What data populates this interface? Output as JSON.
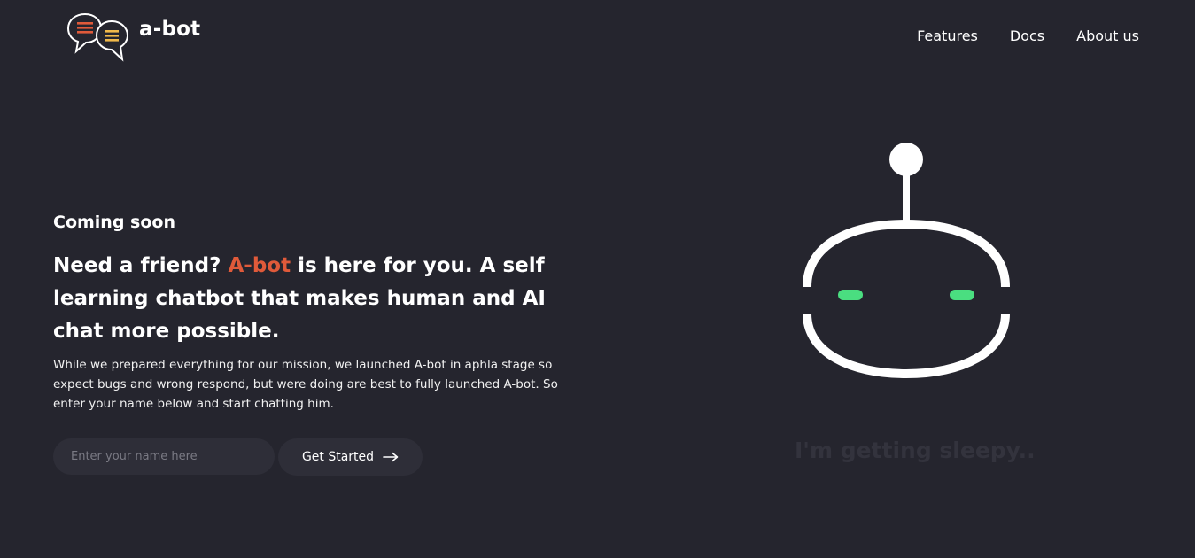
{
  "header": {
    "brand": "a-bot",
    "logo_icon": "chat-bubbles-icon",
    "nav": [
      {
        "label": "Features"
      },
      {
        "label": "Docs"
      },
      {
        "label": "About us"
      }
    ]
  },
  "hero": {
    "eyebrow": "Coming soon",
    "headline_before": "Need a friend? ",
    "headline_accent": "A-bot",
    "headline_after": " is here for you. A self learning chatbot that makes human and AI chat more possible.",
    "description": "While we prepared everything for our mission, we launched A-bot in aphla stage so expect bugs and wrong respond, but were doing are best to fully launched A-bot. So enter your name below and start chatting him.",
    "name_input": {
      "placeholder": "Enter your name here",
      "value": ""
    },
    "cta_label": "Get Started",
    "cta_icon": "arrow-right-icon"
  },
  "robot": {
    "icon": "robot-face-icon",
    "status_text": "I'm getting sleepy.."
  },
  "colors": {
    "background": "#25252e",
    "accent": "#e05a3a",
    "robot_eyes": "#4ade80",
    "field_background": "#2e2e38"
  }
}
